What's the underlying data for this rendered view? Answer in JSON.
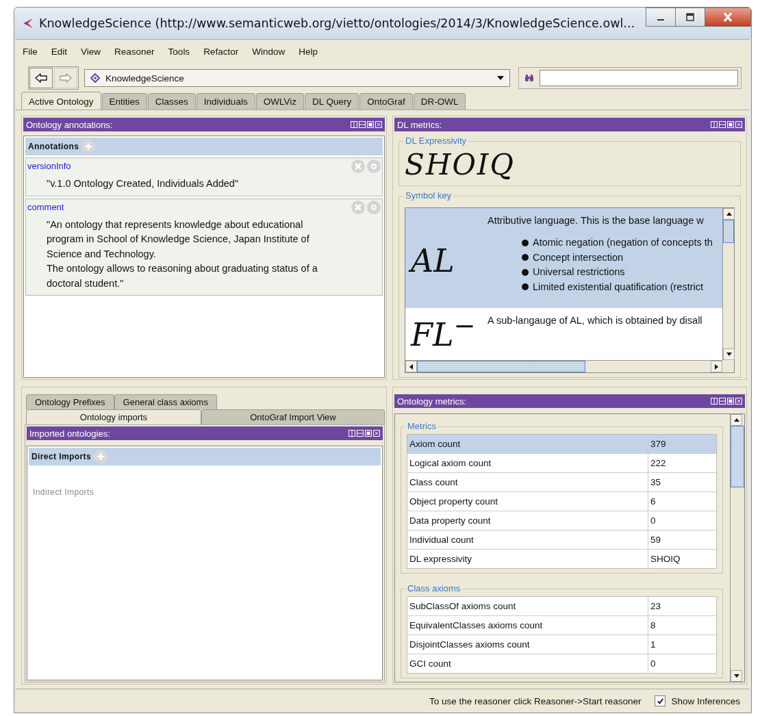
{
  "window": {
    "title": "KnowledgeScience (http://www.semanticweb.org/vietto/ontologies/2014/3/KnowledgeScience.owl..."
  },
  "menu": [
    "File",
    "Edit",
    "View",
    "Reasoner",
    "Tools",
    "Refactor",
    "Window",
    "Help"
  ],
  "toolbar": {
    "back": {
      "disabled": false
    },
    "forward": {
      "disabled": true
    },
    "ontology": "KnowledgeScience"
  },
  "tabs": [
    {
      "label": "Active Ontology",
      "selected": true
    },
    {
      "label": "Entities",
      "selected": false
    },
    {
      "label": "Classes",
      "selected": false
    },
    {
      "label": "Individuals",
      "selected": false
    },
    {
      "label": "OWLViz",
      "selected": false
    },
    {
      "label": "DL Query",
      "selected": false
    },
    {
      "label": "OntoGraf",
      "selected": false
    },
    {
      "label": "DR-OWL",
      "selected": false
    }
  ],
  "annotations_panel": {
    "title": "Ontology annotations:",
    "header": "Annotations",
    "items": [
      {
        "property": "versionInfo",
        "value": "\"v.1.0 Ontology Created, Individuals Added\""
      },
      {
        "property": "comment",
        "value": "\"An ontology that represents knowledge about educational program in School of Knowledge Science, Japan Institute of Science and Technology.\nThe ontology allows to reasoning about graduating status of a doctoral student.\""
      }
    ]
  },
  "dl_metrics": {
    "title": "DL metrics:",
    "expressivity_label": "DL Expressivity",
    "expressivity": "SHOIQ",
    "symbol_key_label": "Symbol key",
    "symbols": [
      {
        "symbol": "AL",
        "description": "Attributive language. This is the base language w",
        "bullets": [
          "Atomic negation (negation of concepts th",
          "Concept intersection",
          "Universal restrictions",
          "Limited existential quatification (restrict"
        ],
        "selected": true
      },
      {
        "symbol": "FL$^{−}$",
        "description": "A sub-langauge of AL, which is obtained by disall",
        "selected": false
      }
    ]
  },
  "import_tab_rows": [
    {
      "tabs": [
        {
          "label": "Ontology Prefixes",
          "selected": false
        },
        {
          "label": "General class axioms",
          "selected": false
        }
      ]
    },
    {
      "tabs": [
        {
          "label": "Ontology imports",
          "selected": true
        },
        {
          "label": "OntoGraf Import View",
          "selected": false
        }
      ]
    }
  ],
  "imports_panel": {
    "title": "Imported ontologies:",
    "direct": "Direct Imports",
    "indirect": "Indirect Imports"
  },
  "ontology_metrics": {
    "title": "Ontology metrics:",
    "sections": [
      {
        "title": "Metrics",
        "rows": [
          {
            "name": "Axiom count",
            "value": "379",
            "selected": true
          },
          {
            "name": "Logical axiom count",
            "value": "222",
            "selected": false
          },
          {
            "name": "Class count",
            "value": "35",
            "selected": false
          },
          {
            "name": "Object property count",
            "value": "6",
            "selected": false
          },
          {
            "name": "Data property count",
            "value": "0",
            "selected": false
          },
          {
            "name": "Individual count",
            "value": "59",
            "selected": false
          },
          {
            "name": "DL expressivity",
            "value": "SHOIQ",
            "selected": false
          }
        ]
      },
      {
        "title": "Class axioms",
        "rows": [
          {
            "name": "SubClassOf axioms count",
            "value": "23",
            "selected": false
          },
          {
            "name": "EquivalentClasses axioms count",
            "value": "8",
            "selected": false
          },
          {
            "name": "DisjointClasses axioms count",
            "value": "1",
            "selected": false
          },
          {
            "name": "GCI count",
            "value": "0",
            "selected": false
          }
        ]
      }
    ]
  },
  "status_bar": {
    "message": "To use the reasoner click Reasoner->Start reasoner",
    "show_inferences": {
      "label": "Show Inferences",
      "checked": true
    }
  }
}
